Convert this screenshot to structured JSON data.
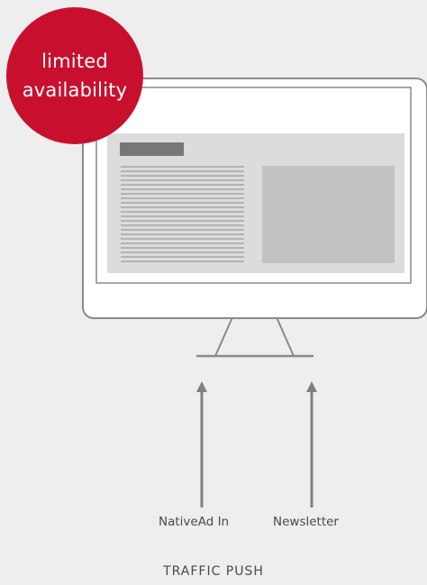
{
  "badge": {
    "line1": "limited",
    "line2": "availability"
  },
  "arrows": {
    "left_label": "NativeAd In",
    "right_label": "Newsletter"
  },
  "footer": {
    "title": "TRAFFIC PUSH"
  },
  "colors": {
    "background": "#efeeee",
    "badge": "#c8102e",
    "monitor_outline": "#8a8a8a",
    "arrow": "#808080",
    "screen_content_bg": "#dcdcdc",
    "header_bar": "#777777",
    "image_placeholder": "#c2c2c2",
    "text_lines": "#8a8a8a"
  },
  "icons": {
    "monitor": "monitor-icon",
    "arrow": "arrow-up-icon"
  }
}
